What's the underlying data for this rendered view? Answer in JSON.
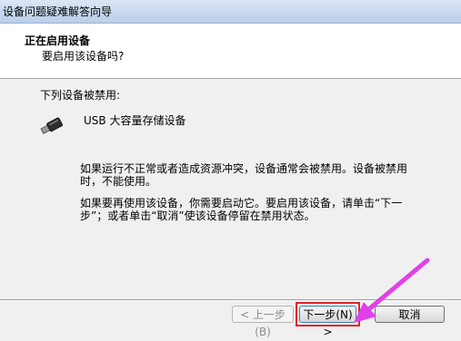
{
  "window": {
    "title": "设备问题疑难解答向导"
  },
  "header": {
    "title": "正在启用设备",
    "subtitle": "要启用该设备吗?"
  },
  "content": {
    "intro": "下列设备被禁用:",
    "device_name": "USB 大容量存储设备",
    "paragraph1": "如果运行不正常或者造成资源冲突，设备通常会被禁用。设备被禁用时，不能使用。",
    "paragraph2": "如果要再使用该设备，你需要启动它。要启用该设备，请单击“下一步”；或者单击“取消”使该设备停留在禁用状态。"
  },
  "buttons": {
    "prev": "< 上一步(B)",
    "next": "下一步(N) >",
    "cancel": "取消"
  },
  "colors": {
    "highlight": "#e3222b",
    "arrow": "#e040e8"
  },
  "icons": {
    "device": "usb-plug-icon",
    "pointer": "arrow-pointer-icon"
  }
}
